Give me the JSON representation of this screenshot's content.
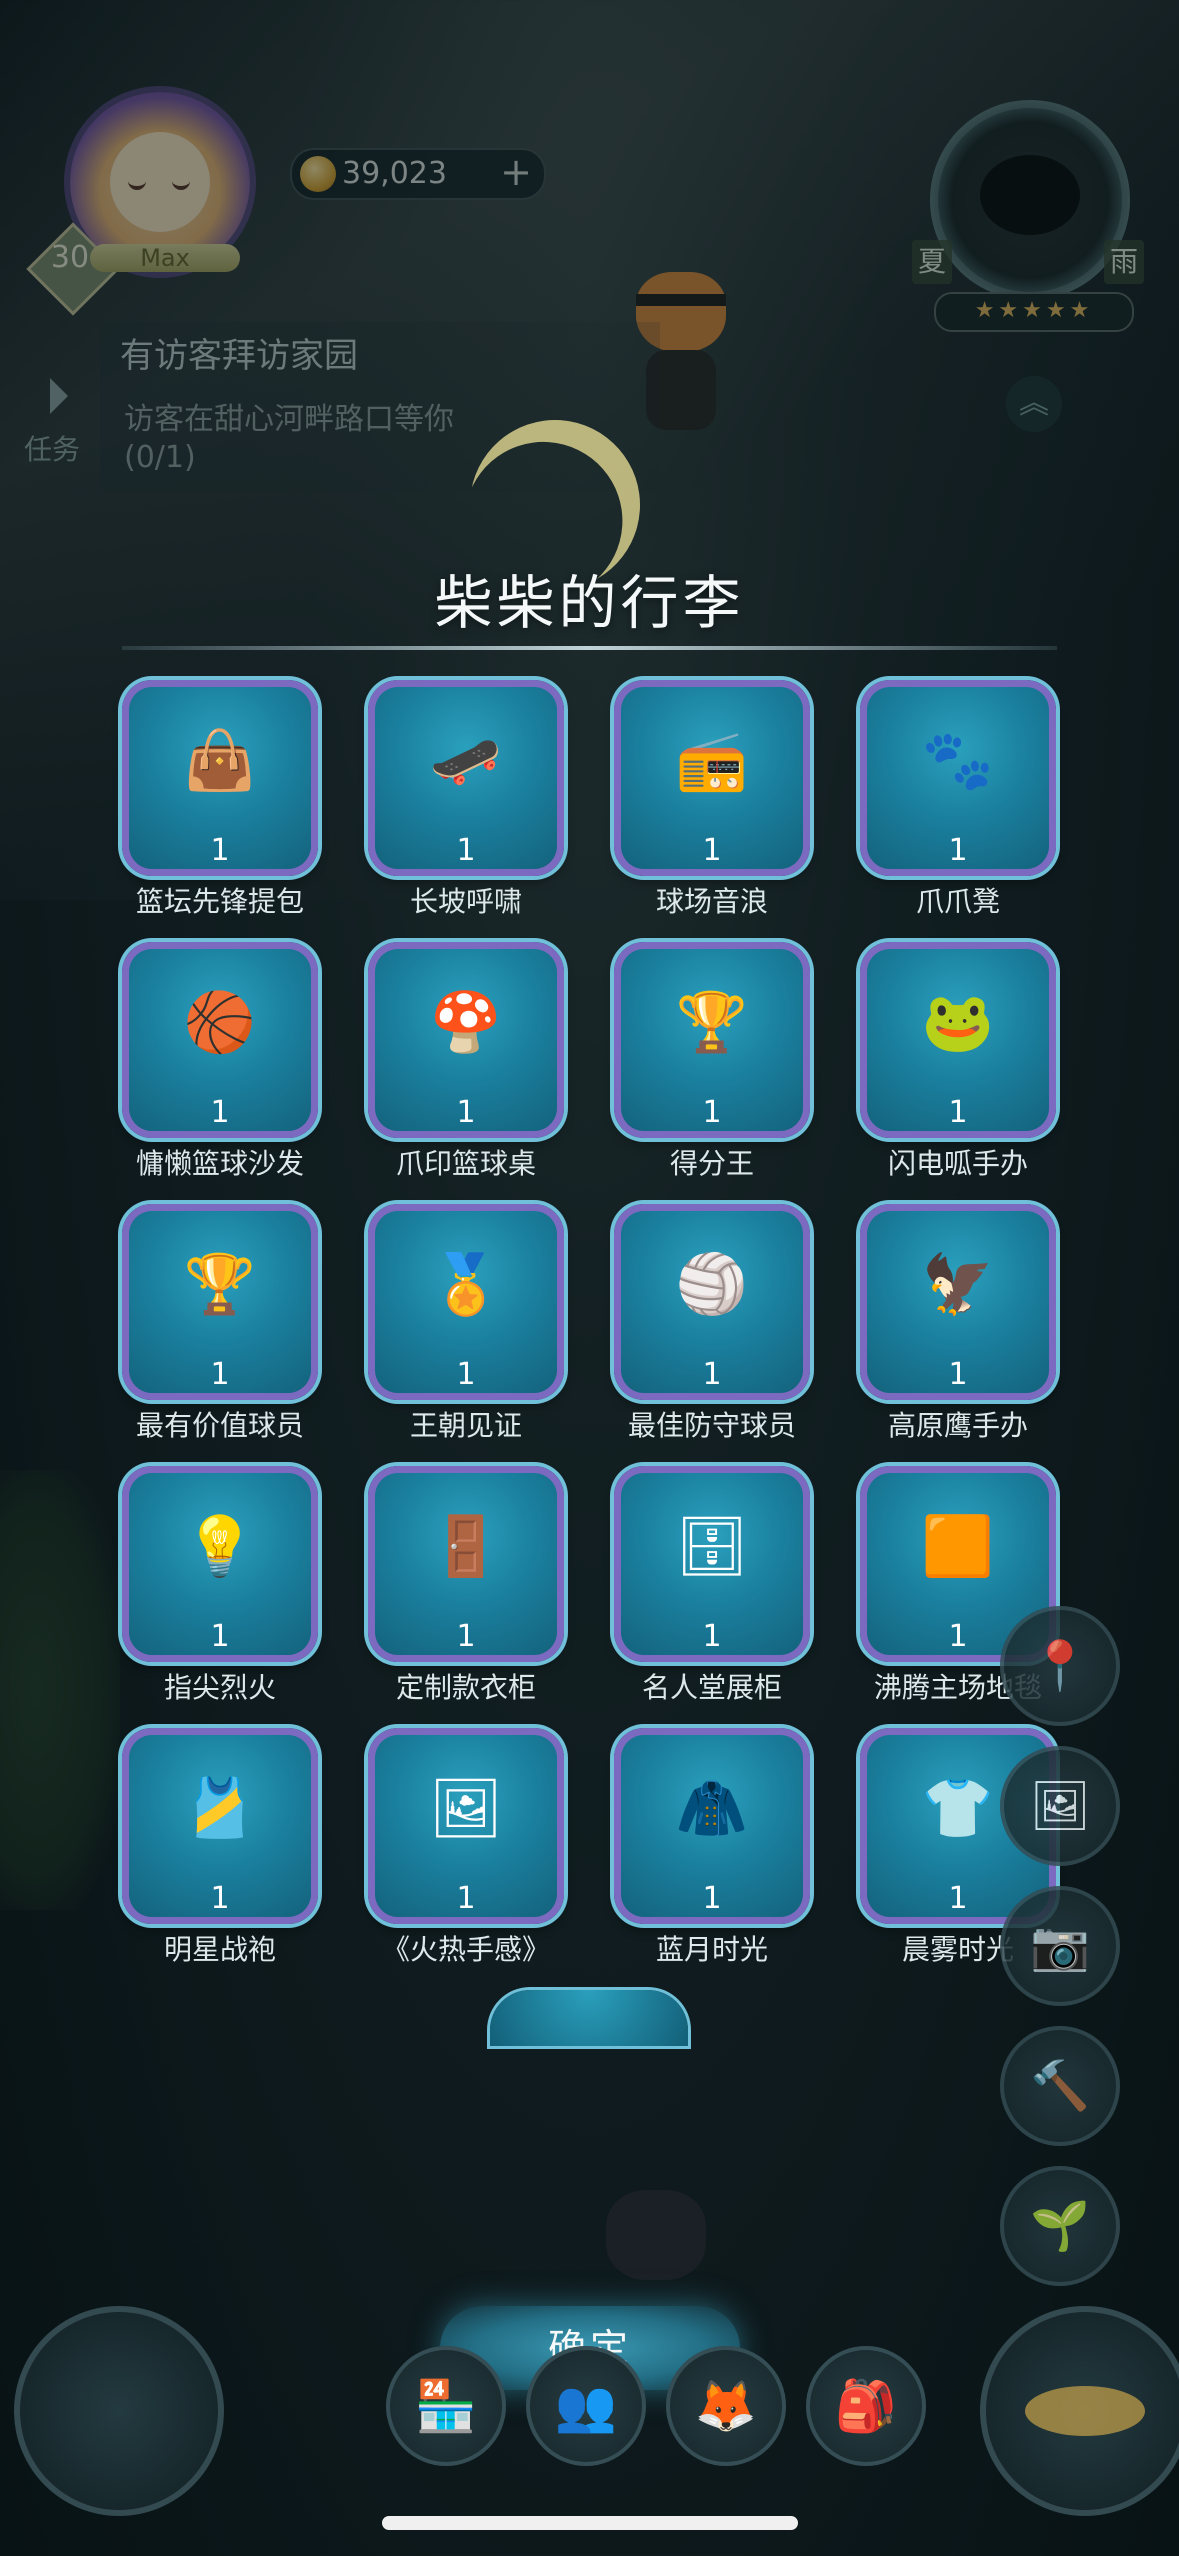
{
  "hud": {
    "level": "30",
    "level_status": "Max",
    "coins": "39,023",
    "coins_add": "+",
    "season_left": "夏",
    "season_right": "雨",
    "stars": "★★★★★"
  },
  "quest": {
    "tab_label": "任务",
    "title": "有访客拜访家园",
    "description": "访客在甜心河畔路口等你",
    "progress": "(0/1)",
    "collapse": "︽"
  },
  "modal": {
    "title": "柴柴的行李",
    "confirm": "确定",
    "items": [
      {
        "name": "篮坛先锋提包",
        "count": "1",
        "icon": "bag-icon",
        "glyph": "👜"
      },
      {
        "name": "长坡呼啸",
        "count": "1",
        "icon": "skateboard-icon",
        "glyph": "🛹"
      },
      {
        "name": "球场音浪",
        "count": "1",
        "icon": "boombox-icon",
        "glyph": "📻"
      },
      {
        "name": "爪爪凳",
        "count": "1",
        "icon": "paw-stool-icon",
        "glyph": "🐾"
      },
      {
        "name": "慵懒篮球沙发",
        "count": "1",
        "icon": "basketball-sofa-icon",
        "glyph": "🏀"
      },
      {
        "name": "爪印篮球桌",
        "count": "1",
        "icon": "paw-table-icon",
        "glyph": "🍄"
      },
      {
        "name": "得分王",
        "count": "1",
        "icon": "trophy-icon",
        "glyph": "🏆"
      },
      {
        "name": "闪电呱手办",
        "count": "1",
        "icon": "frog-figure-icon",
        "glyph": "🐸"
      },
      {
        "name": "最有价值球员",
        "count": "1",
        "icon": "mvp-trophy-icon",
        "glyph": "🏆"
      },
      {
        "name": "王朝见证",
        "count": "1",
        "icon": "dynasty-trophy-icon",
        "glyph": "🏅"
      },
      {
        "name": "最佳防守球员",
        "count": "1",
        "icon": "defense-trophy-icon",
        "glyph": "🏐"
      },
      {
        "name": "高原鹰手办",
        "count": "1",
        "icon": "eagle-figure-icon",
        "glyph": "🦅"
      },
      {
        "name": "指尖烈火",
        "count": "1",
        "icon": "lamp-icon",
        "glyph": "💡"
      },
      {
        "name": "定制款衣柜",
        "count": "1",
        "icon": "wardrobe-icon",
        "glyph": "🚪"
      },
      {
        "name": "名人堂展柜",
        "count": "1",
        "icon": "display-cabinet-icon",
        "glyph": "🗄"
      },
      {
        "name": "沸腾主场地毯",
        "count": "1",
        "icon": "court-rug-icon",
        "glyph": "🟧"
      },
      {
        "name": "明星战袍",
        "count": "1",
        "icon": "jersey-icon",
        "glyph": "🎽"
      },
      {
        "name": "《火热手感》",
        "count": "1",
        "icon": "poster-icon",
        "glyph": "🖼"
      },
      {
        "name": "蓝月时光",
        "count": "1",
        "icon": "hoodie-icon",
        "glyph": "🧥"
      },
      {
        "name": "晨雾时光",
        "count": "1",
        "icon": "shirt-icon",
        "glyph": "👕"
      }
    ]
  },
  "bottom_bar": {
    "buttons": [
      {
        "icon": "shop-icon",
        "glyph": "🏪"
      },
      {
        "icon": "friends-icon",
        "glyph": "👥"
      },
      {
        "icon": "pet-icon",
        "glyph": "🦊"
      },
      {
        "icon": "backpack-icon",
        "glyph": "🎒"
      }
    ]
  },
  "side_buttons": [
    {
      "icon": "pin-icon",
      "glyph": "📍"
    },
    {
      "icon": "album-icon",
      "glyph": "🖼"
    },
    {
      "icon": "camera-icon",
      "glyph": "📷"
    },
    {
      "icon": "hammer-icon",
      "glyph": "🔨"
    },
    {
      "icon": "sprout-icon",
      "glyph": "🌱"
    }
  ]
}
